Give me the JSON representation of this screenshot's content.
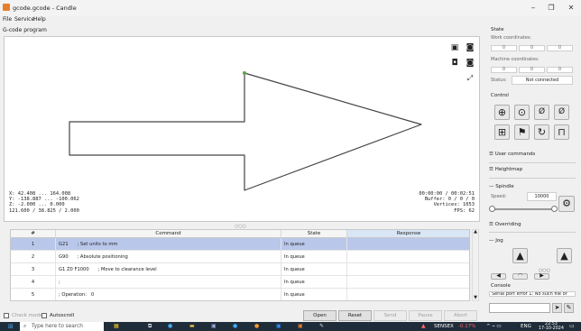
{
  "window": {
    "title": "gcode.gcode - Candle",
    "minimize": "–",
    "maximize": "❐",
    "close": "✕"
  },
  "menu": [
    "File",
    "Service",
    "Help"
  ],
  "gcode_group": {
    "title": "G-code program",
    "info_left": [
      "X: 42.408 ... 164.008",
      "Y: -138.887 ... -100.062",
      "Z: -2.000 ... 0.000",
      "121.600 / 38.825 / 2.000"
    ],
    "info_right": [
      "00:00:00 / 00:02:51",
      "Buffer: 0 / 0 / 0",
      "Vertices: 1053",
      "FPS: 62"
    ],
    "view_icons": [
      "cube-top-icon",
      "cube-front-icon",
      "cube-left-icon",
      "cube-iso-icon",
      "fit-view-icon"
    ]
  },
  "table": {
    "headers": [
      "#",
      "Command",
      "State",
      "Response"
    ],
    "rows": [
      {
        "num": "1",
        "command": "G21      ; Set units to mm",
        "state": "In queue",
        "response": ""
      },
      {
        "num": "2",
        "command": "G90      ; Absolute positioning",
        "state": "In queue",
        "response": ""
      },
      {
        "num": "3",
        "command": "G1 Z0 F1000      ; Move to clearance level",
        "state": "In queue",
        "response": ""
      },
      {
        "num": "4",
        "command": ";",
        "state": "In queue",
        "response": ""
      },
      {
        "num": "5",
        "command": "; Operation:   0",
        "state": "In queue",
        "response": ""
      }
    ]
  },
  "bottom": {
    "check_mode": "Check mode",
    "autoscroll": "Autoscroll",
    "buttons": {
      "open": "Open",
      "reset": "Reset",
      "send": "Send",
      "pause": "Pause",
      "abort": "Abort"
    }
  },
  "right_panel": {
    "state_title": "State",
    "work_coords_label": "Work coordinates:",
    "work_coords": [
      "0",
      "0",
      "0"
    ],
    "machine_coords_label": "Machine coordinates:",
    "machine_coords": [
      "0",
      "0",
      "0"
    ],
    "status_label": "Status:",
    "status_value": "Not connected",
    "control_title": "Control",
    "user_commands": "User commands",
    "heightmap": "Heightmap",
    "spindle_title": "Spindle",
    "speed_label": "Speed:",
    "speed_value": "10000",
    "overriding": "Overriding",
    "jog_title": "Jog",
    "console_title": "Console",
    "console_text": "Serial port error 1: No such file or"
  },
  "taskbar": {
    "search_placeholder": "Type here to search",
    "stock_name": "SENSEX",
    "stock_change": "-0.17%",
    "language": "ENG",
    "time": "22:53",
    "date": "17-10-2024"
  },
  "colors": {
    "selected_row": "#b9c7ea",
    "accent": "#e8802a",
    "taskbar": "#1f2c3a",
    "stock_negative": "#ff6b6b"
  }
}
